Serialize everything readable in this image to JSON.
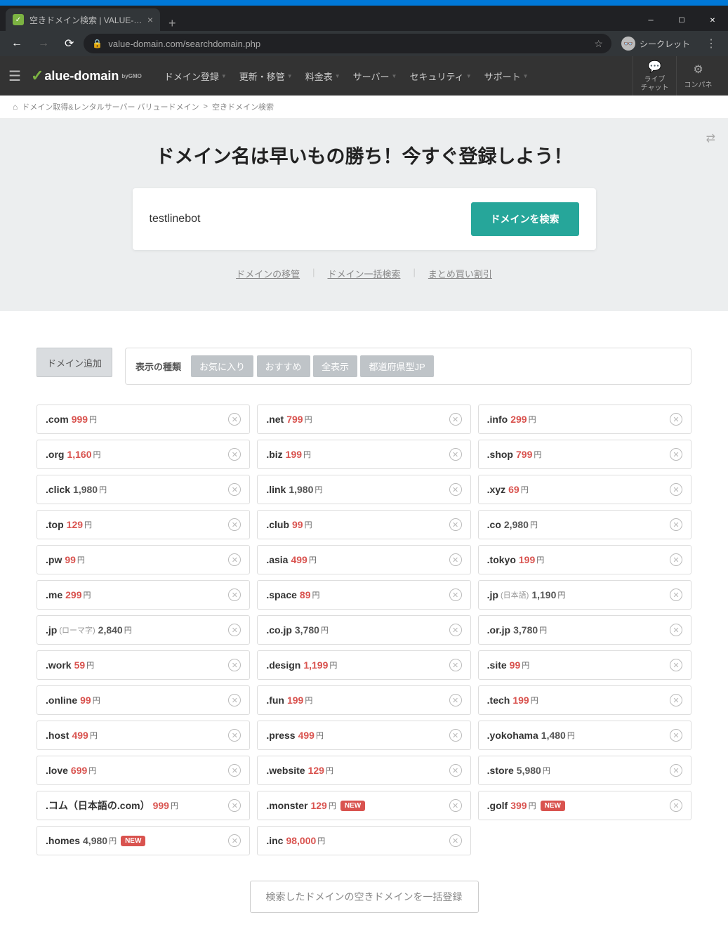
{
  "browser": {
    "tab_title": "空きドメイン検索 | VALUE-DOMAIN",
    "url": "value-domain.com/searchdomain.php",
    "incognito_label": "シークレット"
  },
  "header": {
    "logo_text": "alue-domain",
    "logo_sub": "byGMO",
    "nav": [
      "ドメイン登録",
      "更新・移管",
      "料金表",
      "サーバー",
      "セキュリティ",
      "サポート"
    ],
    "live_chat": "ライブ\nチャット",
    "conpane": "コンパネ"
  },
  "breadcrumb": {
    "root": "ドメイン取得&レンタルサーバー バリュードメイン",
    "sep": ">",
    "current": "空きドメイン検索"
  },
  "hero": {
    "title": "ドメイン名は早いもの勝ち！今すぐ登録しよう！",
    "input_value": "testlinebot",
    "search_label": "ドメインを検索",
    "links": [
      "ドメインの移管",
      "ドメイン一括検索",
      "まとめ買い割引"
    ]
  },
  "controls": {
    "add_domain": "ドメイン追加",
    "filter_label": "表示の種類",
    "filters": [
      "お気に入り",
      "おすすめ",
      "全表示",
      "都道府県型JP"
    ]
  },
  "domains": [
    {
      "tld": ".com",
      "price": "999",
      "highlight": true
    },
    {
      "tld": ".net",
      "price": "799",
      "highlight": true
    },
    {
      "tld": ".info",
      "price": "299",
      "highlight": true
    },
    {
      "tld": ".org",
      "price": "1,160",
      "highlight": true
    },
    {
      "tld": ".biz",
      "price": "199",
      "highlight": true
    },
    {
      "tld": ".shop",
      "price": "799",
      "highlight": true
    },
    {
      "tld": ".click",
      "price": "1,980",
      "highlight": false
    },
    {
      "tld": ".link",
      "price": "1,980",
      "highlight": false
    },
    {
      "tld": ".xyz",
      "price": "69",
      "highlight": true
    },
    {
      "tld": ".top",
      "price": "129",
      "highlight": true
    },
    {
      "tld": ".club",
      "price": "99",
      "highlight": true
    },
    {
      "tld": ".co",
      "price": "2,980",
      "highlight": false
    },
    {
      "tld": ".pw",
      "price": "99",
      "highlight": true
    },
    {
      "tld": ".asia",
      "price": "499",
      "highlight": true
    },
    {
      "tld": ".tokyo",
      "price": "199",
      "highlight": true
    },
    {
      "tld": ".me",
      "price": "299",
      "highlight": true
    },
    {
      "tld": ".space",
      "price": "89",
      "highlight": true
    },
    {
      "tld": ".jp",
      "note": "(日本語)",
      "price": "1,190",
      "highlight": false
    },
    {
      "tld": ".jp",
      "note": "(ローマ字)",
      "price": "2,840",
      "highlight": false
    },
    {
      "tld": ".co.jp",
      "price": "3,780",
      "highlight": false
    },
    {
      "tld": ".or.jp",
      "price": "3,780",
      "highlight": false
    },
    {
      "tld": ".work",
      "price": "59",
      "highlight": true
    },
    {
      "tld": ".design",
      "price": "1,199",
      "highlight": true
    },
    {
      "tld": ".site",
      "price": "99",
      "highlight": true
    },
    {
      "tld": ".online",
      "price": "99",
      "highlight": true
    },
    {
      "tld": ".fun",
      "price": "199",
      "highlight": true
    },
    {
      "tld": ".tech",
      "price": "199",
      "highlight": true
    },
    {
      "tld": ".host",
      "price": "499",
      "highlight": true
    },
    {
      "tld": ".press",
      "price": "499",
      "highlight": true
    },
    {
      "tld": ".yokohama",
      "price": "1,480",
      "highlight": false
    },
    {
      "tld": ".love",
      "price": "699",
      "highlight": true
    },
    {
      "tld": ".website",
      "price": "129",
      "highlight": true
    },
    {
      "tld": ".store",
      "price": "5,980",
      "highlight": false
    },
    {
      "tld": ".コム（日本語の.com）",
      "price": "999",
      "highlight": true
    },
    {
      "tld": ".monster",
      "price": "129",
      "highlight": true,
      "new": true
    },
    {
      "tld": ".golf",
      "price": "399",
      "highlight": true,
      "new": true
    },
    {
      "tld": ".homes",
      "price": "4,980",
      "highlight": false,
      "new": true
    },
    {
      "tld": ".inc",
      "price": "98,000",
      "highlight": true
    }
  ],
  "yen": "円",
  "new_label": "NEW",
  "bulk_register": "検索したドメインの空きドメインを一括登録"
}
